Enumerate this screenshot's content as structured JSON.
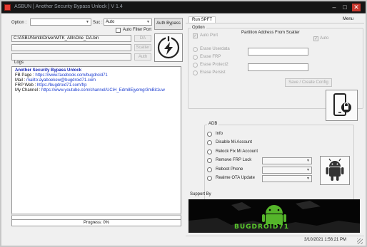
{
  "window": {
    "title": "ASBUN [ Another Security Bypass Unlock ] V 1.4",
    "minimize": "–",
    "maximize": "□",
    "close": "✕"
  },
  "top": {
    "option_label": "Option :",
    "option_value": "",
    "suc_label": "Suc :",
    "suc_value": "Auto",
    "auto_filter_port": "Auto Filter Port",
    "auth_bypass": "Auth Bypass",
    "da_path": "C:\\ASBUN\\mtk\\Driver\\MTK_AllInOne_DA.bin",
    "da_btn": "DA",
    "scatter_btn": "Scatter",
    "auth_btn": "Auth"
  },
  "logs": {
    "label": "Logs",
    "heading": "Another Security Bypass Unlock",
    "lines": [
      {
        "key": "FB Page",
        "sep": " : ",
        "value": "https://www.facebook.com/bugdroid71"
      },
      {
        "key": "Mail",
        "sep": " : ",
        "value": "mailto:ayaboekew@bugdroid71.com"
      },
      {
        "key": "FRP Web",
        "sep": " : ",
        "value": "https://bugdroid71.com/frp"
      },
      {
        "key": "My Channel",
        "sep": " : ",
        "value": "https://www.youtube.com/channel/UCiH_Edm8Ejyemgr3mBit1uw"
      }
    ]
  },
  "progress": {
    "label": "Progress: 0%",
    "value": 0
  },
  "right": {
    "tab_run": "Run SPFT",
    "menu": "Menu",
    "option_label": "Option",
    "auto_port": "Auto Port",
    "partition_label": "Partition Address From Scatter",
    "auto": "Auto",
    "erase_options": [
      "Erase Userdata",
      "Erase FRP",
      "Erase Protect2",
      "Erase Persist"
    ],
    "save_config": "Save / Create Config",
    "adb_label": "ADB",
    "adb_options": [
      "Info",
      "Disable Mi Account",
      "Relock Fix Mi Account",
      "Remove FRP Lock",
      "Reboot Phone",
      "Realme OTA Update"
    ],
    "support_label": "Support By",
    "banner_text": "BUGDROID71",
    "datetime": "3/10/2021 1:56:21 PM"
  },
  "colors": {
    "titlebar": "#151515",
    "link": "#1a3bd0",
    "heading": "#1424b8",
    "banner_green": "#55b52a"
  }
}
